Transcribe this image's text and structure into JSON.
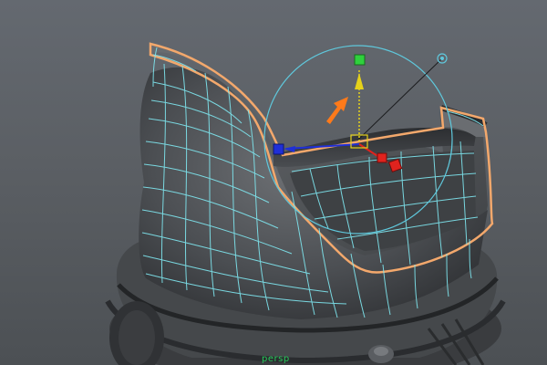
{
  "viewport": {
    "camera_label": "persp",
    "background_color": "#5f6368",
    "wireframe_color": "#7fe7f0",
    "selection_outline_color": "#f3a86c",
    "rotate_manipulator_color": "#5fc8dc"
  },
  "manipulator": {
    "axes": [
      {
        "axis": "y",
        "color": "#2fd13d",
        "icon": "green-cube-handle"
      },
      {
        "axis": "x",
        "color": "#e0231e",
        "icon": "red-cube-handle"
      },
      {
        "axis": "z",
        "color": "#1f2fd8",
        "icon": "blue-cube-handle"
      }
    ],
    "arrow_color": "#e6d21a",
    "annotation_arrow_color": "#ff7a1a"
  }
}
